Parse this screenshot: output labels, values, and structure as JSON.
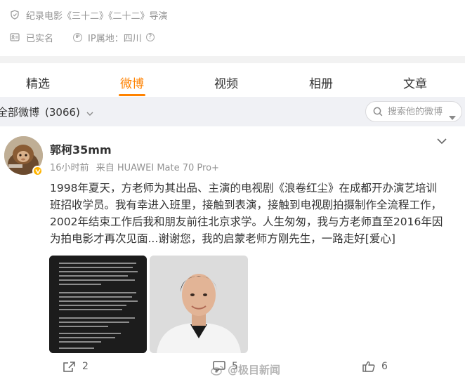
{
  "profile": {
    "bio": "纪录电影《三十二》《二十二》导演",
    "real_name_status": "已实名",
    "ip_label": "IP属地：四川",
    "ip_badge_text": "IP"
  },
  "tabs": [
    {
      "label": "精选",
      "active": false
    },
    {
      "label": "微博",
      "active": true
    },
    {
      "label": "视频",
      "active": false
    },
    {
      "label": "相册",
      "active": false
    },
    {
      "label": "文章",
      "active": false
    }
  ],
  "filter": {
    "label": "全部微博",
    "count": "(3066)",
    "search_placeholder": "搜索他的微博"
  },
  "post": {
    "author": "郭柯35mm",
    "time": "16小时前",
    "source": "来自 HUAWEI Mate 70 Pro+",
    "text_lines": [
      "1998年夏天，方老师为其出品、主演的电视剧《浪卷红尘》在成都开办演艺培训",
      "班招收学员。我有幸进入班里，接触到表演，接触到电视剧拍摄制作全流程工作，",
      "2002年结束工作后我和朋友前往北京求学。人生匆匆，我与方老师直至2016年因",
      "为拍电影才再次见面...谢谢您，我的启蒙老师方刚先生，一路走好[爱心]"
    ],
    "images": [
      {
        "name": "obituary-text-image"
      },
      {
        "name": "portrait-photo"
      }
    ],
    "actions": {
      "repost_count": "2",
      "comment_count": "5",
      "like_count": "6"
    }
  },
  "watermark": "@极目新闻",
  "colors": {
    "accent": "#ff8200",
    "text_primary": "#333333",
    "text_secondary": "#939393",
    "filter_bg": "#f0f1f5"
  },
  "icons": [
    "location-pin-icon",
    "id-card-icon",
    "ip-badge-icon",
    "help-icon",
    "chevron-down-icon",
    "search-icon",
    "verified-badge-icon",
    "repost-icon",
    "comment-icon",
    "like-icon",
    "weibo-logo-icon"
  ]
}
